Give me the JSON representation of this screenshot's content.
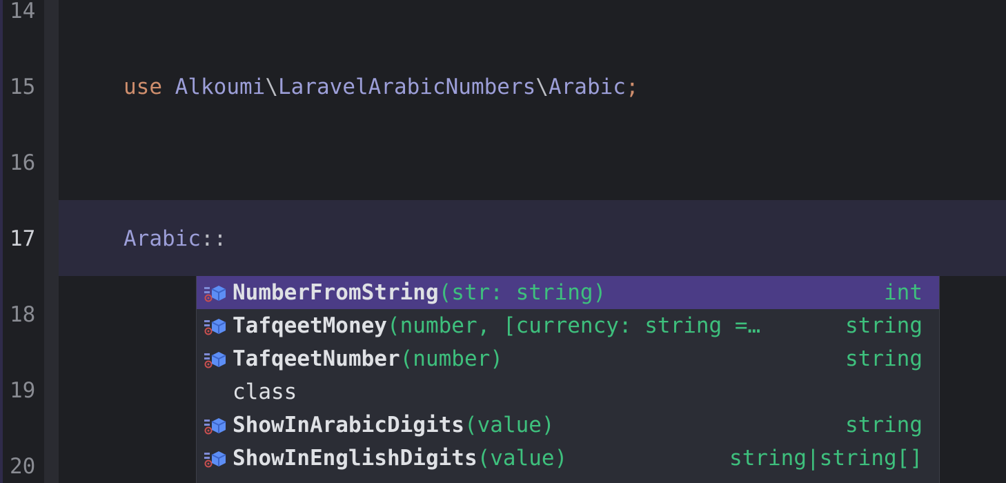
{
  "gutter": {
    "lines": [
      "14",
      "15",
      "16",
      "17",
      "18",
      "19",
      "20"
    ]
  },
  "code": {
    "line15": {
      "keyword": "use",
      "ns1": "Alkoumi",
      "sep1": "\\",
      "ns2": "LaravelArabicNumbers",
      "sep2": "\\",
      "cls": "Arabic",
      "semi": ";"
    },
    "line17": {
      "cls": "Arabic",
      "op": "::"
    }
  },
  "completion": {
    "items": [
      {
        "name": "NumberFromString",
        "sig": "(str: string)",
        "ret": "int",
        "icon": "static-method-icon"
      },
      {
        "name": "TafqeetMoney",
        "sig": "(number, [currency: string =…",
        "ret": "string",
        "icon": "static-method-icon"
      },
      {
        "name": "TafqeetNumber",
        "sig": "(number)",
        "ret": "string",
        "icon": "static-method-icon"
      },
      {
        "name": "class",
        "sig": "",
        "ret": "",
        "icon": ""
      },
      {
        "name": "ShowInArabicDigits",
        "sig": "(value)",
        "ret": "string",
        "icon": "static-method-icon"
      },
      {
        "name": "ShowInEnglishDigits",
        "sig": "(value)",
        "ret": "string|string[]",
        "icon": "static-method-icon"
      }
    ]
  },
  "colors": {
    "selected_bg": "#4b3c86",
    "signature": "#3ec07d",
    "keyword": "#cf8e6d",
    "class": "#9d9fd9"
  }
}
